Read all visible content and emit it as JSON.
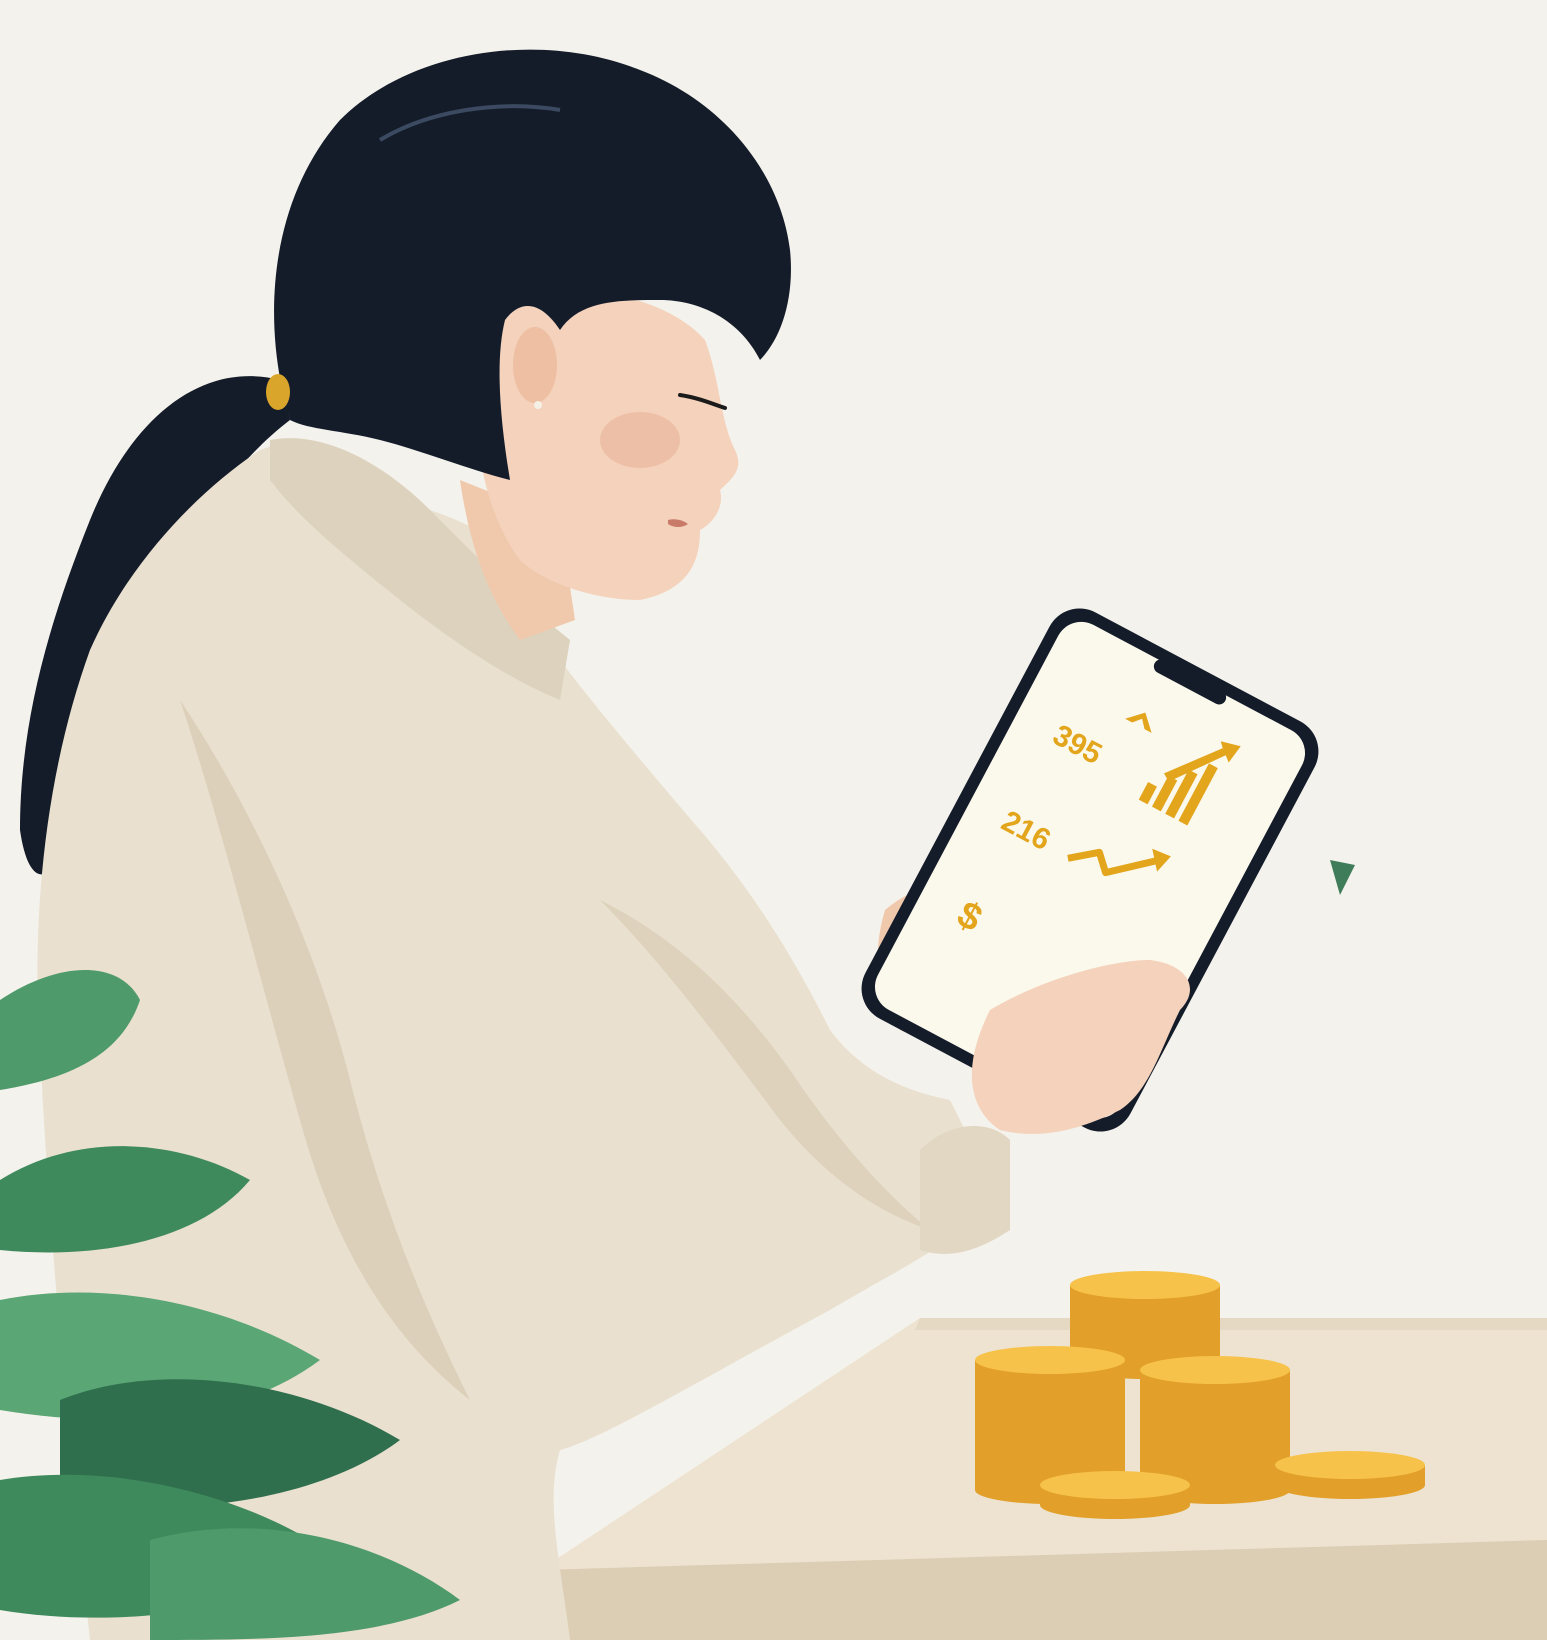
{
  "scene": {
    "subject": "woman-with-ponytail",
    "sweater_color": "#e9e0cf",
    "hair_color": "#141c2a",
    "background_color": "#f4f2ec",
    "table_color": "#ede3d0",
    "coin_color": "#f2b233",
    "leaf_color": "#3f8a5c"
  },
  "phone": {
    "figure_1": "395",
    "figure_2": "216",
    "currency_symbol": "$"
  }
}
